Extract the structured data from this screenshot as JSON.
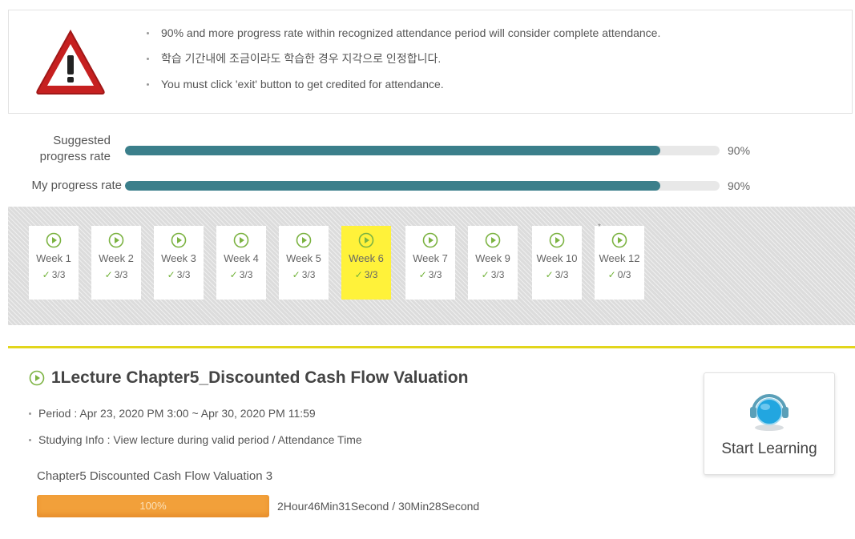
{
  "notice": {
    "items": [
      "90% and more progress rate within recognized attendance period will consider complete attendance.",
      "학습 기간내에 조금이라도 학습한 경우 지각으로 인정합니다.",
      "You must click 'exit' button to get credited for attendance."
    ]
  },
  "progress": {
    "suggested_label_line1": "Suggested",
    "suggested_label_line2": "progress rate",
    "suggested_value": 0.9,
    "suggested_text": "90%",
    "my_label": "My progress rate",
    "my_value": 0.9,
    "my_text": "90%"
  },
  "weeks": [
    {
      "name": "Week 1",
      "count": "3/3"
    },
    {
      "name": "Week 2",
      "count": "3/3"
    },
    {
      "name": "Week 3",
      "count": "3/3"
    },
    {
      "name": "Week 4",
      "count": "3/3"
    },
    {
      "name": "Week 5",
      "count": "3/3"
    },
    {
      "name": "Week 6",
      "count": "3/3"
    },
    {
      "name": "Week 7",
      "count": "3/3"
    },
    {
      "name": "Week 9",
      "count": "3/3"
    },
    {
      "name": "Week 10",
      "count": "3/3"
    },
    {
      "name": "Week 12",
      "count": "0/3"
    }
  ],
  "selected_week": "Week 6",
  "lecture": {
    "title": "1Lecture Chapter5_Discounted Cash Flow Valuation",
    "period": "Period : Apr 23, 2020 PM 3:00 ~ Apr 30, 2020 PM 11:59",
    "studying_info": "Studying Info : View lecture during valid period / Attendance Time",
    "chapter": "Chapter5 Discounted Cash Flow Valuation 3",
    "bar_text": "100%",
    "bar_value": 1.0,
    "time": "2Hour46Min31Second / 30Min28Second",
    "start_label": "Start Learning"
  },
  "colors": {
    "progress_fill": "#3b7f8b",
    "selected_week": "#fff23a",
    "divider": "#e2d61c",
    "lecture_bar": "#f2a03a",
    "play_icon": "#7cb342"
  }
}
